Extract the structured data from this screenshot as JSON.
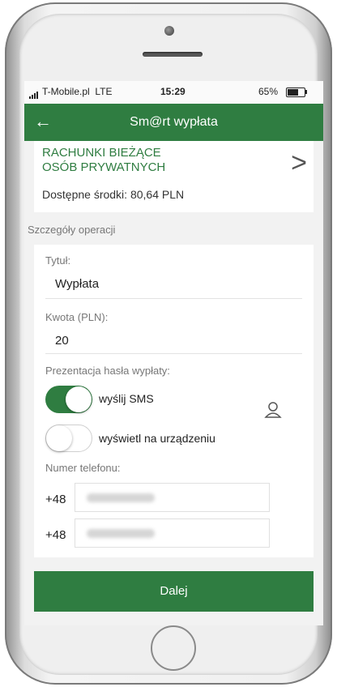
{
  "status_bar": {
    "carrier": "T-Mobile.pl",
    "network": "LTE",
    "time": "15:29",
    "battery": "65%"
  },
  "header": {
    "back_icon": "arrow-left-icon",
    "title": "Sm@rt wypłata"
  },
  "account": {
    "name_line1": "RACHUNKI BIEŻĄCE",
    "name_line2": "OSÓB PRYWATNYCH",
    "available_funds": "Dostępne środki: 80,64 PLN",
    "chevron_icon": "chevron-right-icon"
  },
  "details": {
    "section_label": "Szczegóły operacji",
    "title_label": "Tytuł:",
    "title_value": "Wypłata",
    "amount_label": "Kwota (PLN):",
    "amount_value": "20",
    "presentation_label": "Prezentacja  hasła wypłaty:",
    "option_sms": "wyślij SMS",
    "option_sms_on": true,
    "option_device": "wyświetl na urządzeniu",
    "option_device_on": false,
    "phone_label": "Numer telefonu:",
    "prefix1": "+48",
    "prefix2": "+48",
    "contact_icon": "user-icon"
  },
  "button": {
    "next": "Dalej"
  },
  "colors": {
    "brand_green": "#2f7d41"
  }
}
